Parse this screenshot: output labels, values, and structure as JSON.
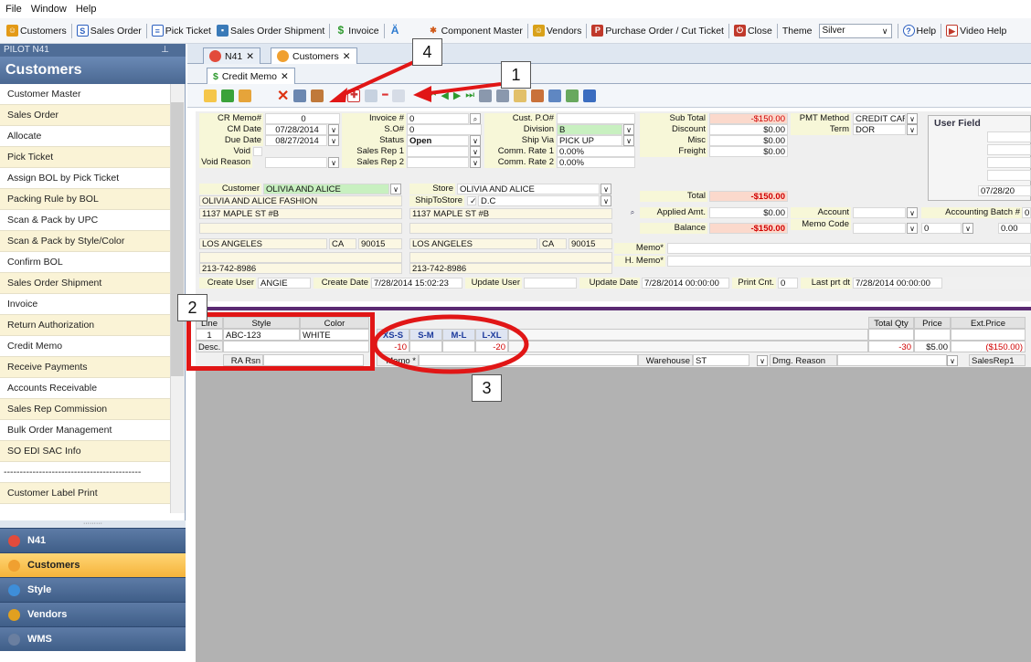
{
  "menubar": [
    "File",
    "Window",
    "Help"
  ],
  "toolbar": {
    "items": [
      {
        "label": "Customers",
        "icon": "customers-icon",
        "color": "#e39a17"
      },
      {
        "label": "Sales Order",
        "icon": "sales-order-icon",
        "color": "#2b5fbf"
      },
      {
        "label": "Pick Ticket",
        "icon": "pick-ticket-icon",
        "color": "#2b5fbf"
      },
      {
        "label": "Sales Order Shipment",
        "icon": "shipment-icon",
        "color": "#3a7ab8"
      },
      {
        "label": "Invoice",
        "icon": "invoice-icon",
        "color": "#2e9a2e"
      },
      {
        "label": "",
        "icon": "style-icon",
        "color": "#2e7bd0"
      },
      {
        "label": "Component Master",
        "icon": "component-icon",
        "color": "#d05a1a"
      },
      {
        "label": "Vendors",
        "icon": "vendors-icon",
        "color": "#d9a11a"
      },
      {
        "label": "Purchase Order / Cut Ticket",
        "icon": "purchase-order-icon",
        "color": "#c0392b"
      },
      {
        "label": "Close",
        "icon": "close-power-icon",
        "color": "#c0392b"
      },
      {
        "label": "Theme",
        "icon": "",
        "color": ""
      }
    ],
    "theme_value": "Silver",
    "help_label": "Help",
    "video_label": "Video Help"
  },
  "left_panel": {
    "header": "PILOT N41",
    "title": "Customers",
    "items": [
      "Customer Master",
      "Sales Order",
      "Allocate",
      "Pick Ticket",
      "Assign BOL by Pick Ticket",
      "Packing Rule by BOL",
      "Scan & Pack by UPC",
      "Scan & Pack by Style/Color",
      "Confirm BOL",
      "Sales Order Shipment",
      "Invoice",
      "Return Authorization",
      "Credit Memo",
      "Receive Payments",
      "Accounts Receivable",
      "Sales Rep Commission",
      "Bulk Order Management",
      "SO EDI SAC Info",
      "-------------------------------------------",
      "Customer Label Print"
    ],
    "nav": [
      {
        "label": "N41",
        "color": "#e24b3b"
      },
      {
        "label": "Customers",
        "color": "#f0a030"
      },
      {
        "label": "Style",
        "color": "#3e8ed8"
      },
      {
        "label": "Vendors",
        "color": "#e0a020"
      },
      {
        "label": "WMS",
        "color": "#6a7fa0"
      }
    ]
  },
  "tabs": [
    {
      "label": "N41"
    },
    {
      "label": "Customers"
    }
  ],
  "subtab": {
    "label": "Credit Memo"
  },
  "form": {
    "cr_memo_label": "CR Memo#",
    "cr_memo": "0",
    "cm_date_label": "CM Date",
    "cm_date": "07/28/2014",
    "due_date_label": "Due Date",
    "due_date": "08/27/2014",
    "void_label": "Void",
    "void_reason_label": "Void Reason",
    "invoice_label": "Invoice #",
    "invoice": "0",
    "so_label": "S.O#",
    "so": "0",
    "status_label": "Status",
    "status": "Open",
    "sales_rep1_label": "Sales Rep 1",
    "sales_rep2_label": "Sales Rep 2",
    "cust_po_label": "Cust. P.O#",
    "division_label": "Division",
    "division": "B",
    "ship_via_label": "Ship Via",
    "ship_via": "PICK UP",
    "comm1_label": "Comm. Rate 1",
    "comm1": "0.00%",
    "comm2_label": "Comm. Rate 2",
    "comm2": "0.00%",
    "subtotal_label": "Sub Total",
    "subtotal": "-$150.00",
    "discount_label": "Discount",
    "discount": "$0.00",
    "misc_label": "Misc",
    "misc": "$0.00",
    "freight_label": "Freight",
    "freight": "$0.00",
    "pmt_label": "PMT Method",
    "pmt": "CREDIT CAR",
    "term_label": "Term",
    "term": "DOR",
    "customer_label": "Customer",
    "customer": "OLIVIA AND ALICE",
    "bill_name": "OLIVIA AND ALICE FASHION",
    "bill_addr": "1137 MAPLE ST #B",
    "bill_city": "LOS ANGELES",
    "bill_state": "CA",
    "bill_zip": "90015",
    "bill_phone": "213-742-8986",
    "store_label": "Store",
    "store": "OLIVIA AND ALICE",
    "shipto_label": "ShipToStore",
    "shipto": "D.C",
    "ship_addr": "1137 MAPLE ST #B",
    "ship_city": "LOS ANGELES",
    "ship_state": "CA",
    "ship_zip": "90015",
    "ship_phone": "213-742-8986",
    "total_label": "Total",
    "total": "-$150.00",
    "applied_label": "Applied Amt.",
    "applied": "$0.00",
    "balance_label": "Balance",
    "balance": "-$150.00",
    "account_label": "Account",
    "memo_code_label": "Memo Code",
    "acct_batch_label": "Accounting Batch #",
    "acct_batch": "0",
    "memo_code_val": "0",
    "memo_amount": "0.00",
    "memo_label": "Memo*",
    "hmemo_label": "H. Memo*",
    "user_field_label": "User Field",
    "user_field_date": "07/28/20"
  },
  "audit": {
    "create_user_label": "Create User",
    "create_user": "ANGIE",
    "create_date_label": "Create Date",
    "create_date": "7/28/2014 15:02:23",
    "update_user_label": "Update User",
    "update_date_label": "Update Date",
    "update_date": "7/28/2014 00:00:00",
    "print_cnt_label": "Print Cnt.",
    "print_cnt": "0",
    "last_prt_label": "Last prt dt",
    "last_prt": "7/28/2014 00:00:00"
  },
  "grid": {
    "line_label": "Line",
    "style_label": "Style",
    "color_label": "Color",
    "line": "1",
    "style": "ABC-123",
    "color": "WHITE",
    "desc_label": "Desc.",
    "sizes": [
      "XS-S",
      "S-M",
      "M-L",
      "L-XL"
    ],
    "size_qty": [
      "-10",
      "",
      "",
      "-20"
    ],
    "total_qty_label": "Total Qty",
    "price_label": "Price",
    "ext_label": "Ext.Price",
    "total_qty": "-30",
    "price": "$5.00",
    "ext_price": "($150.00)",
    "ra_rsn_label": "RA Rsn",
    "memo_label": "Memo *",
    "warehouse_label": "Warehouse",
    "warehouse": "ST",
    "dmg_label": "Dmg. Reason",
    "salesrep_label": "SalesRep1"
  },
  "annotations": [
    "1",
    "2",
    "3",
    "4"
  ],
  "accent": "#e11616"
}
